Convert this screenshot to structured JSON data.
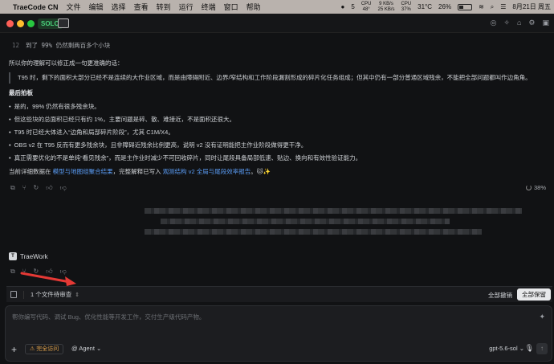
{
  "menubar": {
    "app": "TraeCode CN",
    "items": [
      "文件",
      "编辑",
      "选择",
      "查看",
      "转到",
      "运行",
      "终端",
      "窗口",
      "帮助"
    ],
    "notif_count": "5",
    "cpu_label": "CPU",
    "cpu_value": "48°",
    "net_up": "9 KB/s",
    "net_down": "25 KB/s",
    "cpu2_label": "CPU",
    "cpu2_value": "37%",
    "temp": "31°C",
    "battery": "26%",
    "clock": "8月21日 周五"
  },
  "titlebar": {
    "solo_label": "SOLO"
  },
  "chat": {
    "code_line_no": "12",
    "code_line_text": "到了 99% 仍然剩两百多个小块",
    "intro": "所以你的理解可以修正成一句更准确的话：",
    "quote": "T95 时，剩下的面积大部分已经不是连续的大作业区域，而是由障碍附近、边界/窄结构和工作阶段漏割形成的碎片化任务组成；但其中仍有一部分普通区域残余，不能把全部问题都叫作边角角。",
    "heading": "最后拍板",
    "bullets": [
      "是的，99% 仍然有很多残余块。",
      "但这些块的总面积已经只有约 1%，主要问题是碎、散、难接近，不是面积还很大。",
      "T95 时已经大体进入“边角和局部碎片阶段”，尤其 C1M/X4。",
      "OBS v2 在 T95 反而有更多残余块，且非障碍近残余比例更高，说明 v2 没有证明能把主作业阶段做得更干净。",
      "真正需要优化的不是单纯“看见残余”，而是主作业时减少不可回收碎片，同时让尾段具备局部低速、贴边、换向和有效性验证能力。"
    ],
    "data_prefix": "当前详细数据在 ",
    "data_link1": "模型与地图组聚合结果",
    "data_mid": "，完整解释已写入 ",
    "data_link2": "观测结构 v2 全局与尾段效率报告",
    "data_suffix": "。🐱✨",
    "progress": "38%",
    "agent_name": "TraeWork"
  },
  "pending": {
    "label": "1 个文件待审查",
    "revoke_all": "全部撤销",
    "keep_all": "全部保留"
  },
  "input": {
    "placeholder": "帮你编写代码、调试 Bug、优化性能等开发工作，交付生产级代码产物。",
    "access": "完全访问",
    "mode": "Agent",
    "model": "gpt-5.6-sol"
  }
}
